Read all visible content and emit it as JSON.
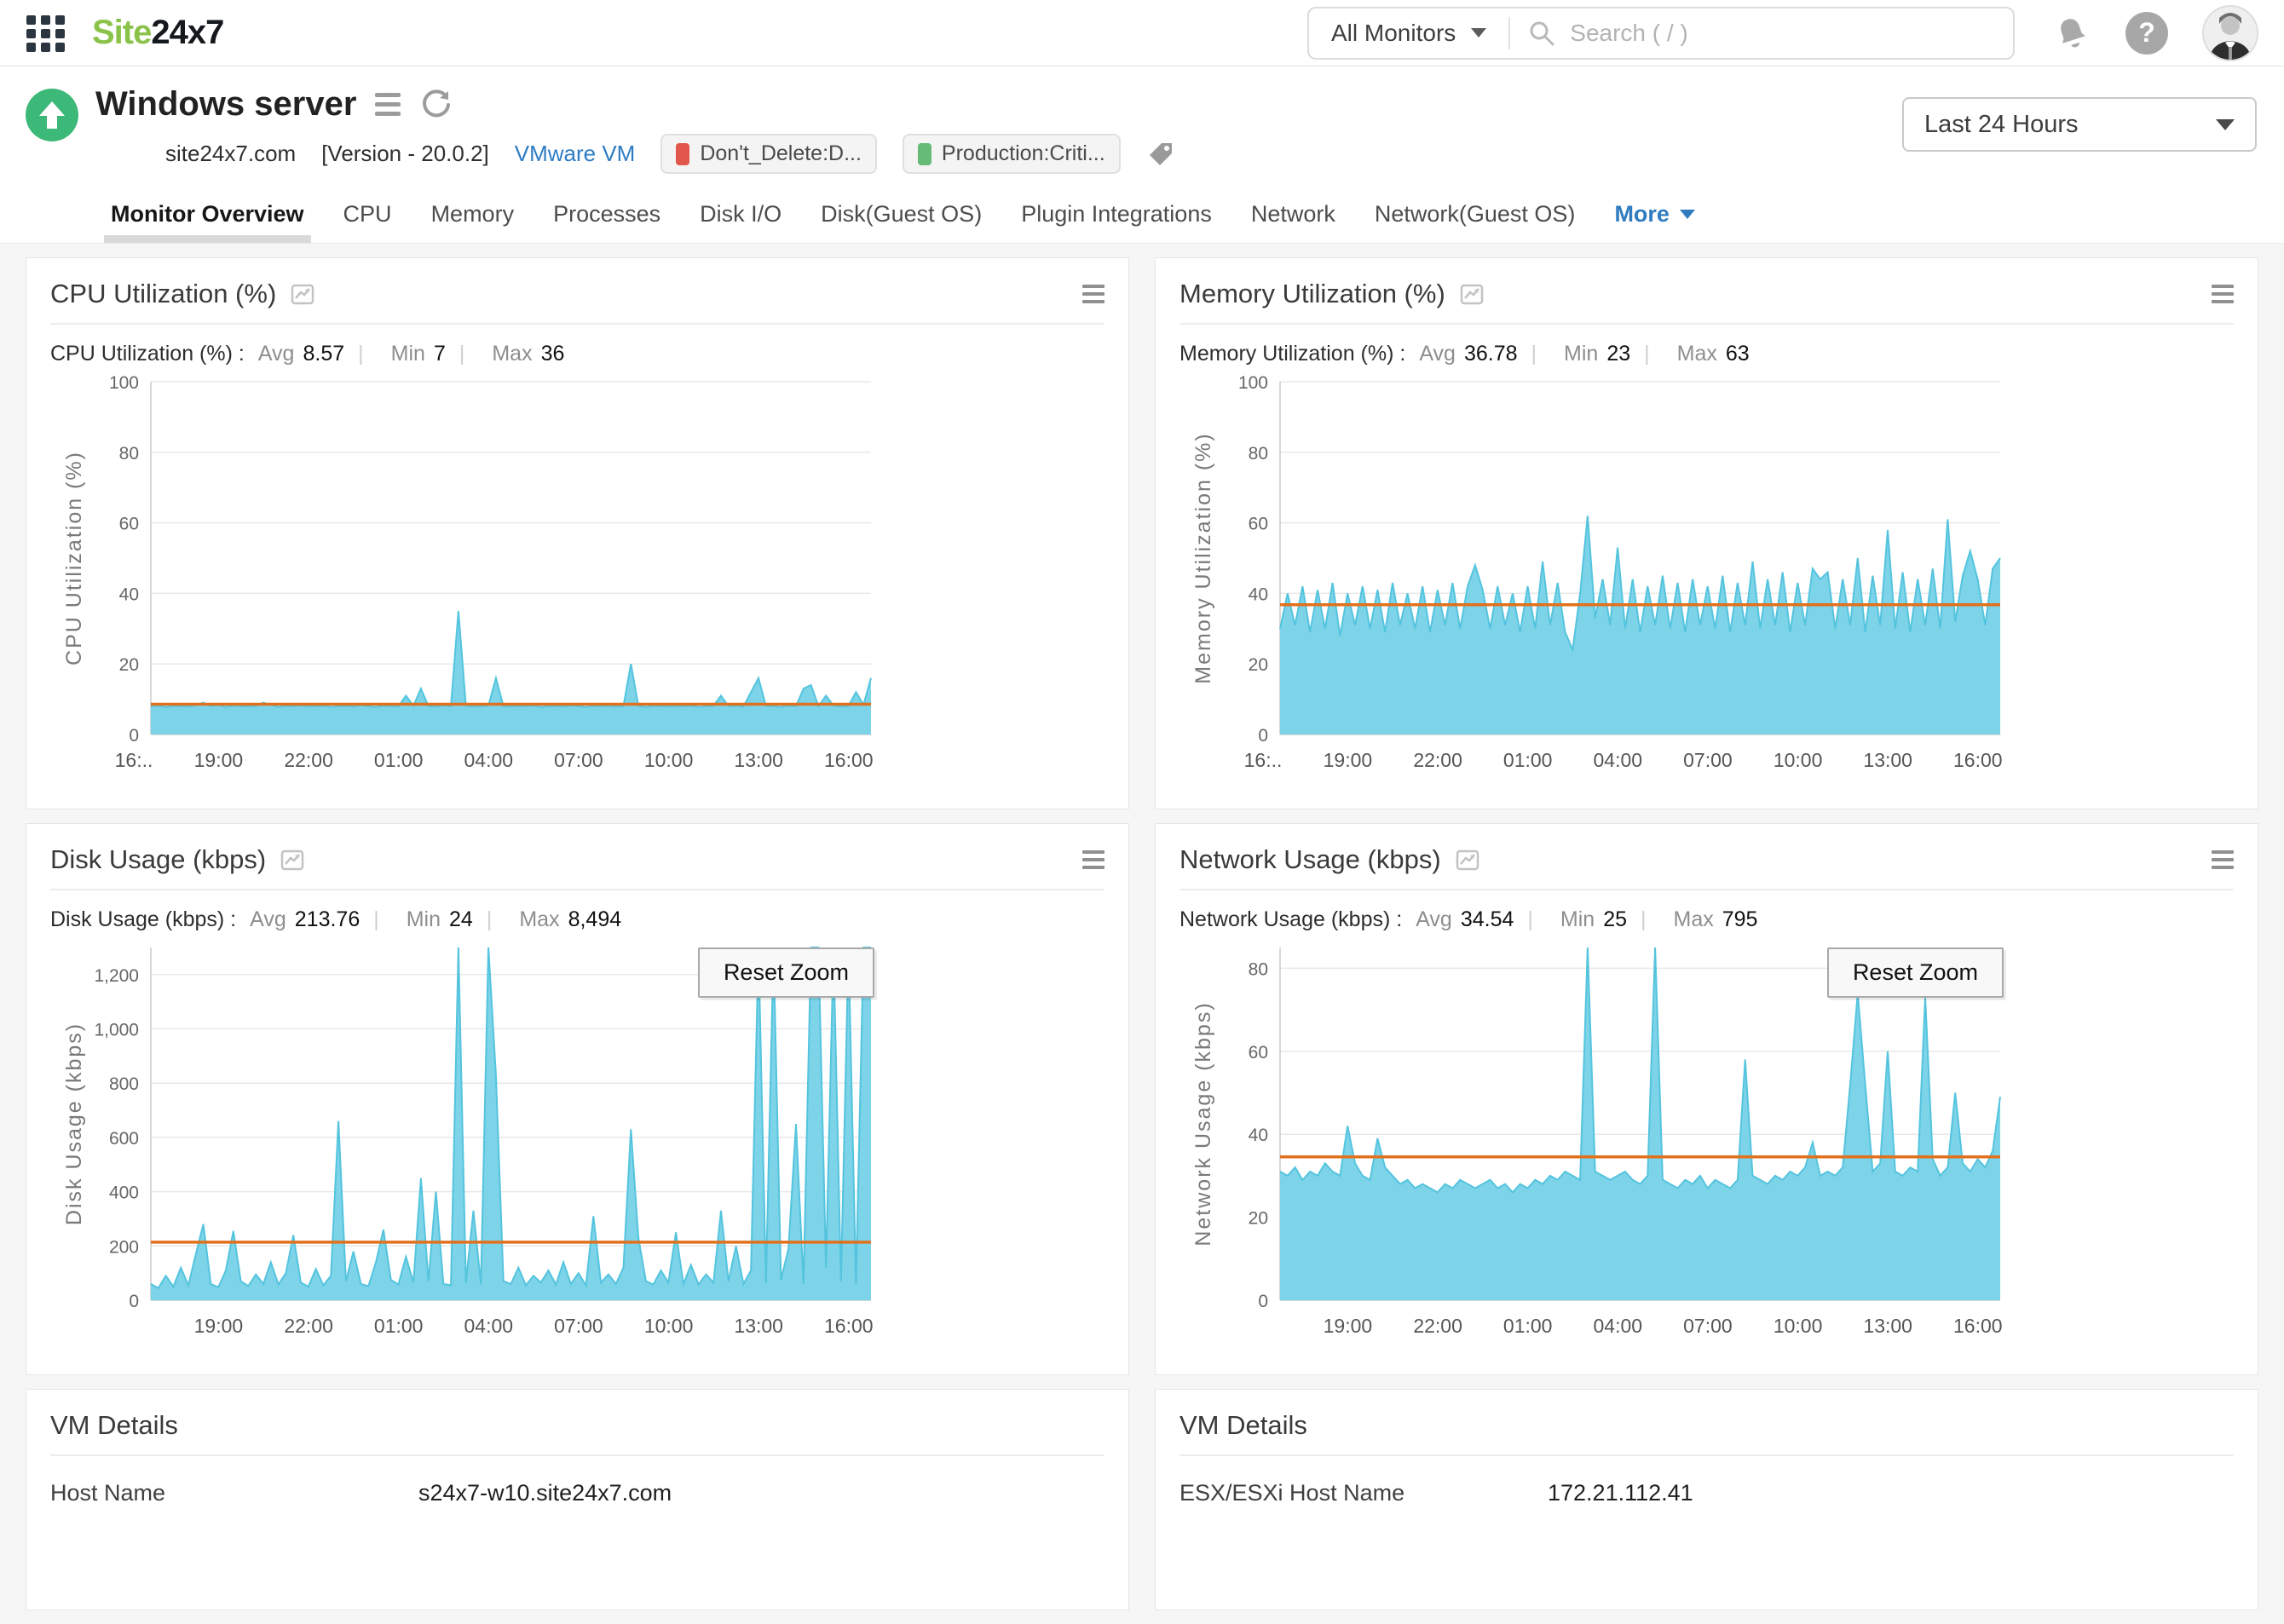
{
  "header": {
    "logo_prefix": "Site",
    "logo_suffix": "24x7",
    "scope_label": "All Monitors",
    "search_placeholder": "Search ( / )",
    "help_glyph": "?"
  },
  "monitor": {
    "title": "Windows server",
    "host": "site24x7.com",
    "version": "[Version - 20.0.2]",
    "type_link": "VMware VM",
    "time_range": "Last 24 Hours",
    "tags": [
      {
        "label": "Don't_Delete:D...",
        "swatch_style": "background:#e2574c"
      },
      {
        "label": "Production:Criti...",
        "swatch_style": "background:#66bb76"
      }
    ]
  },
  "tabs": [
    "Monitor Overview",
    "CPU",
    "Memory",
    "Processes",
    "Disk I/O",
    "Disk(Guest OS)",
    "Plugin Integrations",
    "Network",
    "Network(Guest OS)"
  ],
  "more_label": "More",
  "ui": {
    "avg_label": "Avg",
    "min_label": "Min",
    "max_label": "Max",
    "sep": "|",
    "reset_zoom_label": "Reset Zoom",
    "series_color": "#7dd3e8",
    "series_line_color": "#54c4de",
    "threshold_color": "#e2711d"
  },
  "panels": [
    {
      "title": "CPU Utilization (%)",
      "stats_label": "CPU Utilization (%) :",
      "avg": "8.57",
      "min": "7",
      "max": "36"
    },
    {
      "title": "Memory Utilization (%)",
      "stats_label": "Memory Utilization (%) :",
      "avg": "36.78",
      "min": "23",
      "max": "63"
    },
    {
      "title": "Disk Usage (kbps)",
      "stats_label": "Disk Usage (kbps) :",
      "avg": "213.76",
      "min": "24",
      "max": "8,494"
    },
    {
      "title": "Network Usage (kbps)",
      "stats_label": "Network Usage (kbps) :",
      "avg": "34.54",
      "min": "25",
      "max": "795"
    }
  ],
  "chart_data": [
    {
      "id": "cpu",
      "type": "area",
      "title": "CPU Utilization (%)",
      "ylabel": "CPU Utilization (%)",
      "ylim": [
        0,
        100
      ],
      "yticks": [
        {
          "v": 0,
          "t": "0"
        },
        {
          "v": 20,
          "t": "20"
        },
        {
          "v": 40,
          "t": "40"
        },
        {
          "v": 60,
          "t": "60"
        },
        {
          "v": 80,
          "t": "80"
        },
        {
          "v": 100,
          "t": "100"
        }
      ],
      "xlabels": [
        {
          "p": 0,
          "t": "16:.."
        },
        {
          "p": 0.094,
          "t": "19:00"
        },
        {
          "p": 0.219,
          "t": "22:00"
        },
        {
          "p": 0.344,
          "t": "01:00"
        },
        {
          "p": 0.469,
          "t": "04:00"
        },
        {
          "p": 0.594,
          "t": "07:00"
        },
        {
          "p": 0.719,
          "t": "10:00"
        },
        {
          "p": 0.844,
          "t": "13:00"
        },
        {
          "p": 0.969,
          "t": "16:00"
        }
      ],
      "threshold": 8.57,
      "avg": 8.57,
      "min": 7,
      "max": 36,
      "reset_zoom": false,
      "values": [
        8,
        8.2,
        7.8,
        8.1,
        8,
        7.9,
        8.3,
        9,
        8,
        8.4,
        7.8,
        8.2,
        8,
        7.9,
        8.1,
        9,
        8.4,
        7.8,
        8.1,
        8,
        8.3,
        7.9,
        8,
        8.2,
        7.8,
        8,
        8.1,
        7.9,
        8.3,
        8,
        7.8,
        8.2,
        8,
        7.9,
        11,
        8.1,
        13,
        8,
        7.9,
        8.2,
        8,
        35,
        8.1,
        7.9,
        8,
        8.2,
        16,
        8,
        7.9,
        8.1,
        8,
        8.2,
        7.8,
        8,
        8.1,
        7.9,
        8.2,
        8,
        7.8,
        8.1,
        8,
        8.2,
        7.9,
        8,
        20,
        8.1,
        7.8,
        8.2,
        8,
        7.9,
        8.1,
        8,
        8.2,
        7.8,
        8,
        8.1,
        11,
        8,
        8.2,
        7.9,
        12,
        16,
        8,
        8.1,
        7.8,
        8.2,
        8,
        13,
        14,
        8,
        11,
        8.2,
        7.9,
        8.1,
        12,
        8.4,
        16
      ]
    },
    {
      "id": "memory",
      "type": "area",
      "title": "Memory Utilization (%)",
      "ylabel": "Memory Utilization (%)",
      "ylim": [
        0,
        100
      ],
      "yticks": [
        {
          "v": 0,
          "t": "0"
        },
        {
          "v": 20,
          "t": "20"
        },
        {
          "v": 40,
          "t": "40"
        },
        {
          "v": 60,
          "t": "60"
        },
        {
          "v": 80,
          "t": "80"
        },
        {
          "v": 100,
          "t": "100"
        }
      ],
      "xlabels": [
        {
          "p": 0,
          "t": "16:.."
        },
        {
          "p": 0.094,
          "t": "19:00"
        },
        {
          "p": 0.219,
          "t": "22:00"
        },
        {
          "p": 0.344,
          "t": "01:00"
        },
        {
          "p": 0.469,
          "t": "04:00"
        },
        {
          "p": 0.594,
          "t": "07:00"
        },
        {
          "p": 0.719,
          "t": "10:00"
        },
        {
          "p": 0.844,
          "t": "13:00"
        },
        {
          "p": 0.969,
          "t": "16:00"
        }
      ],
      "threshold": 36.78,
      "avg": 36.78,
      "min": 23,
      "max": 63,
      "reset_zoom": false,
      "values": [
        30,
        40,
        31,
        42,
        29,
        41,
        30,
        43,
        28,
        40,
        31,
        42,
        30,
        41,
        29,
        43,
        31,
        40,
        30,
        42,
        29,
        41,
        31,
        43,
        30,
        42,
        48,
        41,
        30,
        42,
        31,
        40,
        29,
        42,
        30,
        49,
        31,
        43,
        29,
        24,
        40,
        62,
        33,
        44,
        31,
        53,
        30,
        44,
        29,
        42,
        31,
        45,
        30,
        43,
        29,
        44,
        31,
        42,
        30,
        45,
        29,
        43,
        31,
        49,
        30,
        44,
        31,
        46,
        29,
        43,
        31,
        47,
        44,
        46,
        30,
        44,
        31,
        50,
        29,
        45,
        31,
        58,
        30,
        46,
        29,
        44,
        31,
        47,
        30,
        61,
        32,
        45,
        52,
        44,
        31,
        47,
        50
      ]
    },
    {
      "id": "disk",
      "type": "area",
      "title": "Disk Usage (kbps)",
      "ylabel": "Disk Usage (kbps)",
      "ylim": [
        0,
        1300
      ],
      "yticks": [
        {
          "v": 0,
          "t": "0"
        },
        {
          "v": 200,
          "t": "200"
        },
        {
          "v": 400,
          "t": "400"
        },
        {
          "v": 600,
          "t": "600"
        },
        {
          "v": 800,
          "t": "800"
        },
        {
          "v": 1000,
          "t": "1,000"
        },
        {
          "v": 1200,
          "t": "1,200"
        }
      ],
      "xlabels": [
        {
          "p": 0.094,
          "t": "19:00"
        },
        {
          "p": 0.219,
          "t": "22:00"
        },
        {
          "p": 0.344,
          "t": "01:00"
        },
        {
          "p": 0.469,
          "t": "04:00"
        },
        {
          "p": 0.594,
          "t": "07:00"
        },
        {
          "p": 0.719,
          "t": "10:00"
        },
        {
          "p": 0.844,
          "t": "13:00"
        },
        {
          "p": 0.969,
          "t": "16:00"
        }
      ],
      "threshold": 213.76,
      "avg": 213.76,
      "min": 24,
      "max": 8494,
      "reset_zoom": true,
      "values": [
        60,
        45,
        90,
        50,
        120,
        55,
        170,
        280,
        60,
        48,
        110,
        255,
        70,
        52,
        95,
        60,
        140,
        58,
        100,
        240,
        65,
        50,
        115,
        55,
        90,
        660,
        70,
        180,
        60,
        52,
        140,
        260,
        75,
        58,
        160,
        65,
        450,
        70,
        400,
        60,
        55,
        8494,
        65,
        330,
        58,
        8300,
        830,
        70,
        60,
        120,
        55,
        90,
        65,
        110,
        58,
        140,
        60,
        100,
        55,
        310,
        65,
        95,
        60,
        120,
        630,
        230,
        70,
        58,
        110,
        65,
        250,
        60,
        130,
        58,
        95,
        65,
        330,
        70,
        200,
        60,
        110,
        2000,
        65,
        1500,
        75,
        190,
        650,
        60,
        3000,
        2500,
        120,
        1600,
        70,
        1800,
        60,
        1700,
        1750
      ]
    },
    {
      "id": "network",
      "type": "area",
      "title": "Network Usage (kbps)",
      "ylabel": "Network Usage (kbps)",
      "ylim": [
        0,
        85
      ],
      "yticks": [
        {
          "v": 0,
          "t": "0"
        },
        {
          "v": 20,
          "t": "20"
        },
        {
          "v": 40,
          "t": "40"
        },
        {
          "v": 60,
          "t": "60"
        },
        {
          "v": 80,
          "t": "80"
        }
      ],
      "xlabels": [
        {
          "p": 0.094,
          "t": "19:00"
        },
        {
          "p": 0.219,
          "t": "22:00"
        },
        {
          "p": 0.344,
          "t": "01:00"
        },
        {
          "p": 0.469,
          "t": "04:00"
        },
        {
          "p": 0.594,
          "t": "07:00"
        },
        {
          "p": 0.719,
          "t": "10:00"
        },
        {
          "p": 0.844,
          "t": "13:00"
        },
        {
          "p": 0.969,
          "t": "16:00"
        }
      ],
      "threshold": 34.54,
      "avg": 34.54,
      "min": 25,
      "max": 795,
      "reset_zoom": true,
      "values": [
        31,
        30,
        32,
        29,
        31,
        30,
        33,
        31,
        30,
        42,
        33,
        30,
        29,
        39,
        32,
        30,
        28,
        29,
        27,
        28,
        27,
        26,
        28,
        27,
        29,
        28,
        27,
        28,
        29,
        27,
        28,
        26,
        28,
        27,
        29,
        28,
        30,
        29,
        31,
        30,
        29,
        795,
        31,
        30,
        29,
        30,
        31,
        29,
        28,
        30,
        430,
        29,
        28,
        27,
        29,
        28,
        30,
        27,
        29,
        28,
        27,
        29,
        58,
        30,
        29,
        28,
        30,
        29,
        31,
        30,
        32,
        38,
        30,
        31,
        30,
        32,
        52,
        74,
        52,
        31,
        33,
        60,
        31,
        30,
        32,
        31,
        73,
        34,
        30,
        32,
        50,
        33,
        31,
        34,
        32,
        36,
        49
      ]
    }
  ],
  "vm_details": [
    {
      "title": "VM Details",
      "rows": [
        {
          "label": "Host Name",
          "value": "s24x7-w10.site24x7.com"
        }
      ]
    },
    {
      "title": "VM Details",
      "rows": [
        {
          "label": "ESX/ESXi Host Name",
          "value": "172.21.112.41"
        }
      ]
    }
  ]
}
